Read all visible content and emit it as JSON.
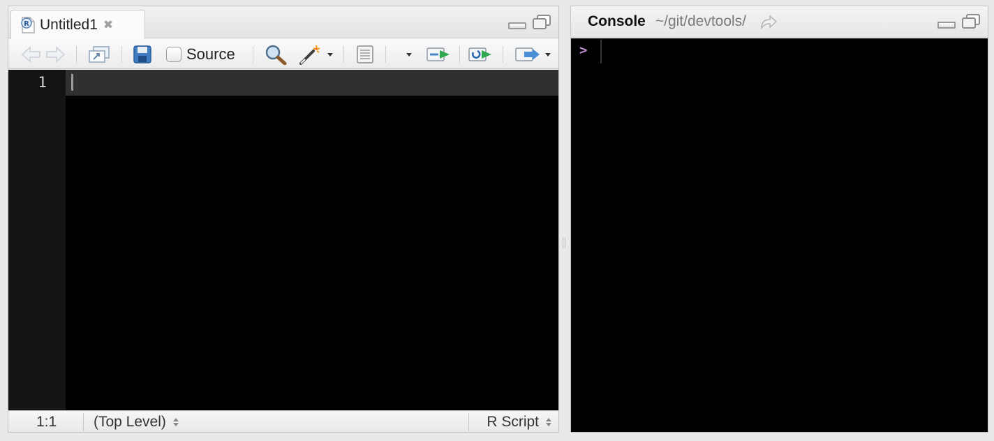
{
  "editor": {
    "tab": {
      "label": "Untitled1",
      "close": "✖"
    },
    "toolbar": {
      "source_label": "Source"
    },
    "gutter": {
      "line_numbers": [
        "1"
      ]
    },
    "status": {
      "position": "1:1",
      "scope": "(Top Level)",
      "file_type": "R Script"
    }
  },
  "console": {
    "title": "Console",
    "path": "~/git/devtools/",
    "prompt": ">"
  },
  "colors": {
    "editor_background": "#000000",
    "active_line": "#303030",
    "prompt": "#c78fd8"
  }
}
